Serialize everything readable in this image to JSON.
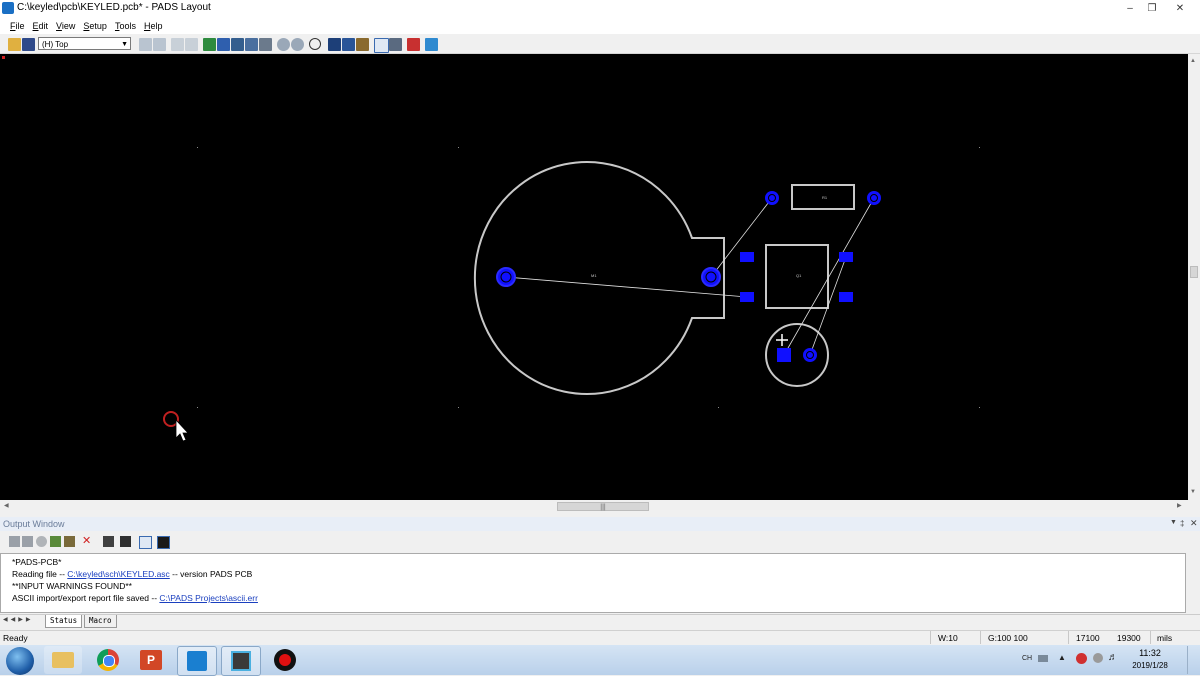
{
  "window": {
    "title": "C:\\keyled\\pcb\\KEYLED.pcb* - PADS Layout",
    "buttons": [
      "minimize-icon",
      "restore-icon",
      "close-icon"
    ]
  },
  "menu": [
    "File",
    "Edit",
    "View",
    "Setup",
    "Tools",
    "Help"
  ],
  "toolbar": {
    "layer_value": "(H) Top"
  },
  "canvas": {
    "background": "#000000",
    "outline_color": "#c8c8c8",
    "pad_color": "#1010ff",
    "ratline_color": "#e0e0e0",
    "component_labels": [
      "M1",
      "R1",
      "Q1"
    ]
  },
  "output": {
    "title": "Output Window",
    "lines": [
      {
        "text": "*PADS-PCB*"
      },
      {
        "prefix": "Reading file -- ",
        "link": "C:\\keyled\\sch\\KEYLED.asc",
        "suffix": "  -- version PADS PCB"
      },
      {
        "text": "**INPUT WARNINGS FOUND**"
      },
      {
        "prefix": "ASCII import/export report file saved -- ",
        "link": "C:\\PADS Projects\\ascii.err",
        "suffix": ""
      }
    ],
    "tabs": [
      "Status",
      "Macro"
    ]
  },
  "status": {
    "ready": "Ready",
    "width": "W:10",
    "grid": "G:100 100",
    "x": "17100",
    "y": "19300",
    "units": "mils"
  },
  "taskbar": {
    "apps": [
      "start-orb-icon",
      "file-explorer-icon",
      "chrome-icon",
      "powerpoint-icon",
      "pads-icon",
      "pads-router-icon",
      "record-icon"
    ],
    "time": "11:32",
    "date": "2019/1/28",
    "input_method": "CH"
  }
}
